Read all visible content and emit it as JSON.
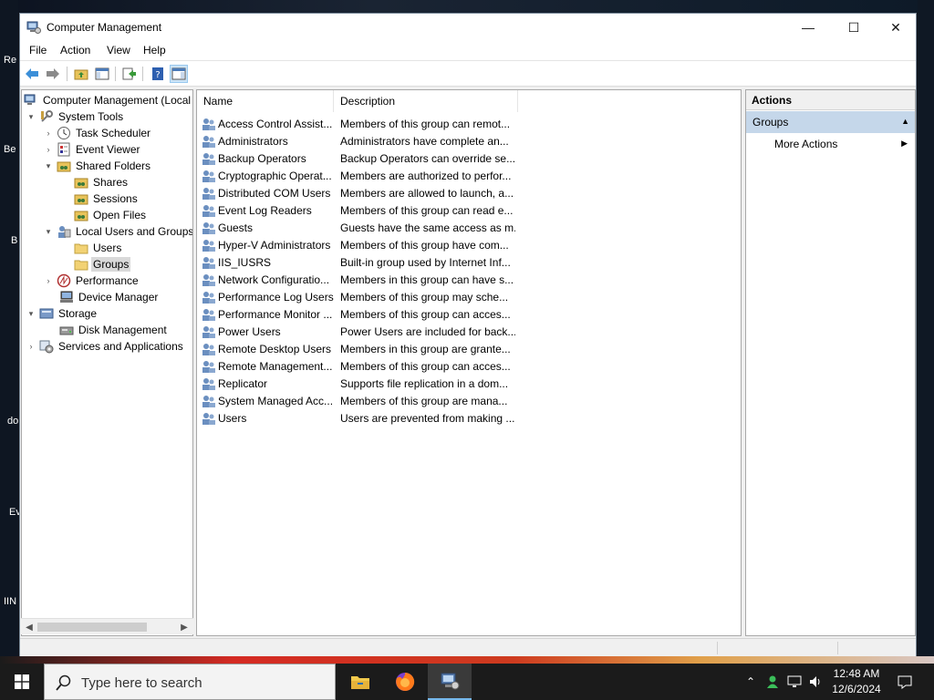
{
  "window": {
    "title": "Computer Management",
    "minimize_glyph": "—",
    "maximize_glyph": "☐",
    "close_glyph": "✕"
  },
  "menu": [
    "File",
    "Action",
    "View",
    "Help"
  ],
  "toolbar": {
    "icons": [
      "back-arrow-icon",
      "forward-arrow-icon",
      "up-folder-icon",
      "show-hide-tree-icon",
      "export-list-icon",
      "help-icon",
      "action-pane-icon"
    ]
  },
  "tree": {
    "items": [
      {
        "label": "Computer Management (Local",
        "expander": "",
        "icon": "computer-management-icon"
      },
      {
        "label": "System Tools",
        "expander": "▾",
        "icon": "system-tools-icon"
      },
      {
        "label": "Task Scheduler",
        "expander": "›",
        "icon": "clock-icon"
      },
      {
        "label": "Event Viewer",
        "expander": "›",
        "icon": "event-viewer-icon"
      },
      {
        "label": "Shared Folders",
        "expander": "▾",
        "icon": "shared-folder-icon"
      },
      {
        "label": "Shares",
        "expander": "",
        "icon": "shared-folder-icon"
      },
      {
        "label": "Sessions",
        "expander": "",
        "icon": "shared-folder-icon"
      },
      {
        "label": "Open Files",
        "expander": "",
        "icon": "shared-folder-icon"
      },
      {
        "label": "Local Users and Groups",
        "expander": "▾",
        "icon": "users-groups-icon"
      },
      {
        "label": "Users",
        "expander": "",
        "icon": "folder-icon"
      },
      {
        "label": "Groups",
        "expander": "",
        "icon": "folder-icon"
      },
      {
        "label": "Performance",
        "expander": "›",
        "icon": "performance-icon"
      },
      {
        "label": "Device Manager",
        "expander": "",
        "icon": "device-manager-icon"
      },
      {
        "label": "Storage",
        "expander": "▾",
        "icon": "storage-icon"
      },
      {
        "label": "Disk Management",
        "expander": "",
        "icon": "disk-icon"
      },
      {
        "label": "Services and Applications",
        "expander": "›",
        "icon": "services-icon"
      }
    ],
    "selected": "Groups"
  },
  "list": {
    "columns": [
      "Name",
      "Description"
    ],
    "rows": [
      {
        "name": "Access Control Assist...",
        "desc": "Members of this group can remot..."
      },
      {
        "name": "Administrators",
        "desc": "Administrators have complete an..."
      },
      {
        "name": "Backup Operators",
        "desc": "Backup Operators can override se..."
      },
      {
        "name": "Cryptographic Operat...",
        "desc": "Members are authorized to perfor..."
      },
      {
        "name": "Distributed COM Users",
        "desc": "Members are allowed to launch, a..."
      },
      {
        "name": "Event Log Readers",
        "desc": "Members of this group can read e..."
      },
      {
        "name": "Guests",
        "desc": "Guests have the same access as m..."
      },
      {
        "name": "Hyper-V Administrators",
        "desc": "Members of this group have com..."
      },
      {
        "name": "IIS_IUSRS",
        "desc": "Built-in group used by Internet Inf..."
      },
      {
        "name": "Network Configuratio...",
        "desc": "Members in this group can have s..."
      },
      {
        "name": "Performance Log Users",
        "desc": "Members of this group may sche..."
      },
      {
        "name": "Performance Monitor ...",
        "desc": "Members of this group can acces..."
      },
      {
        "name": "Power Users",
        "desc": "Power Users are included for back..."
      },
      {
        "name": "Remote Desktop Users",
        "desc": "Members in this group are grante..."
      },
      {
        "name": "Remote Management...",
        "desc": "Members of this group can acces..."
      },
      {
        "name": "Replicator",
        "desc": "Supports file replication in a dom..."
      },
      {
        "name": "System Managed Acc...",
        "desc": "Members of this group are mana..."
      },
      {
        "name": "Users",
        "desc": "Users are prevented from making ..."
      }
    ]
  },
  "actions": {
    "header": "Actions",
    "group": "Groups",
    "more": "More Actions"
  },
  "taskbar": {
    "search_placeholder": "Type here to search",
    "time": "12:48 AM",
    "date": "12/6/2024",
    "apps": [
      "file-explorer-icon",
      "firefox-icon",
      "computer-management-icon"
    ]
  },
  "desktop": {
    "labels": [
      "Re",
      "Be",
      "B",
      "do",
      "Ev",
      "IIN"
    ]
  },
  "colors": {
    "selection": "#cce4f7",
    "actions_group_bg": "#c5d7ea",
    "taskbar": "#1b1b1b"
  }
}
